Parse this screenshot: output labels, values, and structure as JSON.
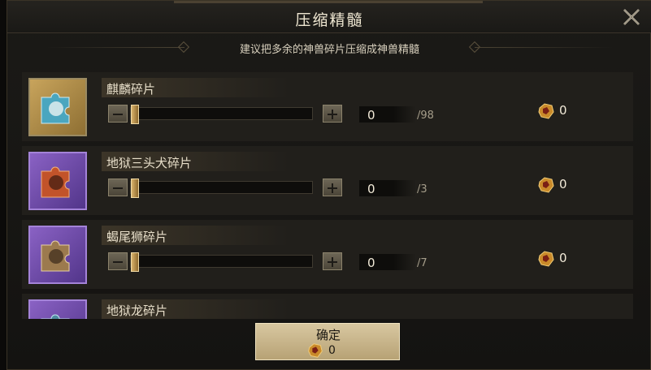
{
  "dialog": {
    "title": "压缩精髓",
    "hint": "建议把多余的神兽碎片压缩成神兽精髓"
  },
  "items": [
    {
      "name": "麒麟碎片",
      "quantity": "0",
      "max": "/98",
      "reward": "0",
      "rarity": "gold"
    },
    {
      "name": "地狱三头犬碎片",
      "quantity": "0",
      "max": "/3",
      "reward": "0",
      "rarity": "purple"
    },
    {
      "name": "蝎尾狮碎片",
      "quantity": "0",
      "max": "/7",
      "reward": "0",
      "rarity": "purple"
    },
    {
      "name": "地狱龙碎片",
      "quantity": "",
      "max": "",
      "reward": "",
      "rarity": "purple"
    }
  ],
  "confirm": {
    "label": "确定",
    "cost": "0"
  },
  "colors": {
    "gold_frame": "#c8a45c",
    "purple_frame": "#8a62c4",
    "accent": "#d9b26b"
  },
  "icons": [
    "close-icon",
    "beast-fragment-icon",
    "essence-icon",
    "minus-icon",
    "plus-icon"
  ]
}
